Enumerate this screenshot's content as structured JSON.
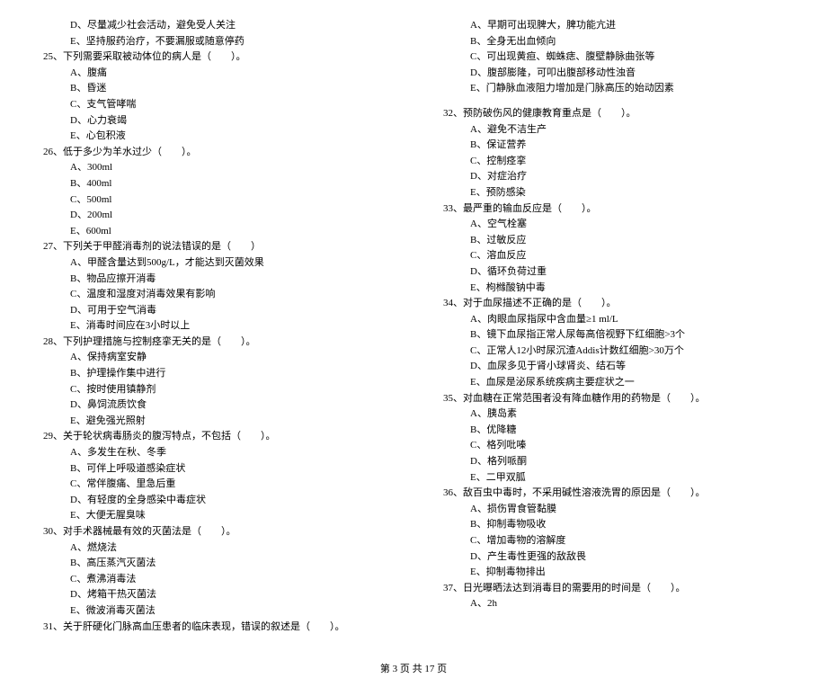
{
  "left": {
    "pre_options": [
      "D、尽量减少社会活动，避免受人关注",
      "E、坚持服药治疗，不要漏服或随意停药"
    ],
    "q25": {
      "stem": "25、下列需要采取被动体位的病人是（　　）。",
      "opts": [
        "A、腹痛",
        "B、昏迷",
        "C、支气管哮喘",
        "D、心力衰竭",
        "E、心包积液"
      ]
    },
    "q26": {
      "stem": "26、低于多少为羊水过少（　　）。",
      "opts": [
        "A、300ml",
        "B、400ml",
        "C、500ml",
        "D、200ml",
        "E、600ml"
      ]
    },
    "q27": {
      "stem": "27、下列关于甲醛消毒剂的说法错误的是（　　）",
      "opts": [
        "A、甲醛含量达到500g/L，才能达到灭菌效果",
        "B、物品应擦开消毒",
        "C、温度和湿度对消毒效果有影响",
        "D、可用于空气消毒",
        "E、消毒时间应在3小时以上"
      ]
    },
    "q28": {
      "stem": "28、下列护理措施与控制痉挛无关的是（　　）。",
      "opts": [
        "A、保持病室安静",
        "B、护理操作集中进行",
        "C、按时使用镇静剂",
        "D、鼻饲流质饮食",
        "E、避免强光照射"
      ]
    },
    "q29": {
      "stem": "29、关于轮状病毒肠炎的腹泻特点，不包括（　　）。",
      "opts": [
        "A、多发生在秋、冬季",
        "B、可伴上呼吸道感染症状",
        "C、常伴腹痛、里急后重",
        "D、有轻度的全身感染中毒症状",
        "E、大便无腥臭味"
      ]
    },
    "q30": {
      "stem": "30、对手术器械最有效的灭菌法是（　　）。",
      "opts": [
        "A、燃烧法",
        "B、高压蒸汽灭菌法",
        "C、煮沸消毒法",
        "D、烤箱干热灭菌法",
        "E、微波消毒灭菌法"
      ]
    },
    "q31": {
      "stem": "31、关于肝硬化门脉高血压患者的临床表现，错误的叙述是（　　）。"
    }
  },
  "right": {
    "q31_opts": [
      "A、早期可出现脾大，脾功能亢进",
      "B、全身无出血倾向",
      "C、可出现黄疸、蜘蛛痣、腹壁静脉曲张等",
      "D、腹部膨隆，可叩出腹部移动性浊音",
      "E、门静脉血液阻力增加是门脉高压的始动因素"
    ],
    "q32": {
      "stem": "32、预防破伤风的健康教育重点是（　　）。",
      "opts": [
        "A、避免不洁生产",
        "B、保证营养",
        "C、控制痉挛",
        "D、对症治疗",
        "E、预防感染"
      ]
    },
    "q33": {
      "stem": "33、最严重的输血反应是（　　）。",
      "opts": [
        "A、空气栓塞",
        "B、过敏反应",
        "C、溶血反应",
        "D、循环负荷过重",
        "E、枸橼酸钠中毒"
      ]
    },
    "q34": {
      "stem": "34、对于血尿描述不正确的是（　　）。",
      "opts": [
        "A、肉眼血尿指尿中含血量≥1 ml/L",
        "B、镜下血尿指正常人尿每高倍视野下红细胞>3个",
        "C、正常人12小时尿沉渣Addis计数红细胞>30万个",
        "D、血尿多见于肾小球肾炎、结石等",
        "E、血尿是泌尿系统疾病主要症状之一"
      ]
    },
    "q35": {
      "stem": "35、对血糖在正常范围者没有降血糖作用的药物是（　　）。",
      "opts": [
        "A、胰岛素",
        "B、优降糖",
        "C、格列吡嗪",
        "D、格列哌酮",
        "E、二甲双胍"
      ]
    },
    "q36": {
      "stem": "36、敌百虫中毒时，不采用碱性溶液洗胃的原因是（　　）。",
      "opts": [
        "A、损伤胃食管黏膜",
        "B、抑制毒物吸收",
        "C、增加毒物的溶解度",
        "D、产生毒性更强的敌敌畏",
        "E、抑制毒物排出"
      ]
    },
    "q37": {
      "stem": "37、日光曝晒法达到消毒目的需要用的时间是（　　）。",
      "opts": [
        "A、2h"
      ]
    }
  },
  "footer": "第 3 页 共 17 页"
}
